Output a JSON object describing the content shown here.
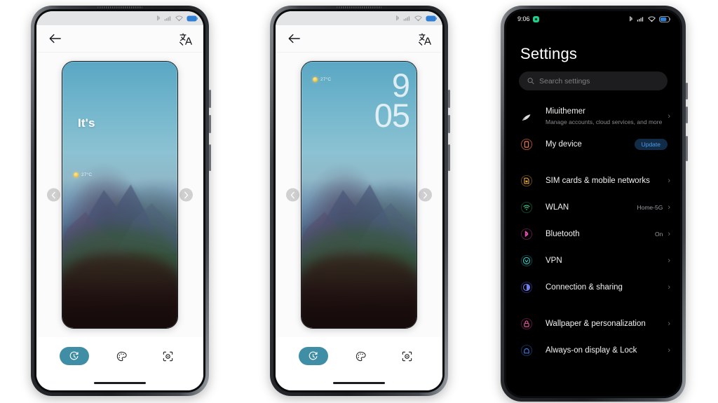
{
  "phones": {
    "wallpaper_clock": {
      "name": "Wallpaper preview - It's",
      "statusbar": {
        "icons": [
          "bluetooth-icon",
          "signal-icon",
          "wifi-icon",
          "battery-icon"
        ]
      },
      "appbar": {
        "back_icon": "back-arrow-icon",
        "translate_icon": "translate-icon"
      },
      "wallpaper": {
        "overlay_text": "It's",
        "weather_temp": "27°C",
        "weather_icon": "sun-icon"
      },
      "carousel": {
        "prev_icon": "chevron-left-icon",
        "next_icon": "chevron-right-icon"
      },
      "toolbar": {
        "items": [
          {
            "icon": "clock-timer-icon",
            "active": true
          },
          {
            "icon": "palette-icon",
            "active": false
          },
          {
            "icon": "focus-frame-icon",
            "active": false
          }
        ]
      }
    },
    "wallpaper_time": {
      "name": "Wallpaper preview - clock",
      "statusbar": {
        "icons": [
          "bluetooth-icon",
          "signal-icon",
          "wifi-icon",
          "battery-icon"
        ]
      },
      "appbar": {
        "back_icon": "back-arrow-icon",
        "translate_icon": "translate-icon"
      },
      "wallpaper": {
        "clock_hour": "9",
        "clock_minute": "05",
        "weather_temp": "27°C",
        "weather_icon": "sun-icon"
      },
      "carousel": {
        "prev_icon": "chevron-left-icon",
        "next_icon": "chevron-right-icon"
      },
      "toolbar": {
        "items": [
          {
            "icon": "clock-timer-icon",
            "active": true
          },
          {
            "icon": "palette-icon",
            "active": false
          },
          {
            "icon": "focus-frame-icon",
            "active": false
          }
        ]
      }
    },
    "settings": {
      "name": "Settings app",
      "statusbar": {
        "time": "9:06",
        "indicator_icon": "green-record-icon",
        "icons": [
          "bluetooth-icon",
          "signal-icon",
          "wifi-icon",
          "battery-icon"
        ]
      },
      "title": "Settings",
      "search": {
        "placeholder": "Search settings",
        "value": "",
        "icon": "search-icon"
      },
      "groups": [
        {
          "rows": [
            {
              "icon": "account-feather-icon",
              "icon_color": "#d9d9d9",
              "title": "Miuithemer",
              "subtitle": "Manage accounts, cloud services, and more",
              "value": "",
              "badge": "",
              "chevron": "›"
            },
            {
              "icon": "device-phone-icon",
              "icon_color": "#e0643c",
              "title": "My device",
              "subtitle": "",
              "value": "",
              "badge": "Update",
              "chevron": ""
            }
          ]
        },
        {
          "rows": [
            {
              "icon": "sim-card-icon",
              "icon_color": "#e0a32e",
              "title": "SIM cards & mobile networks",
              "subtitle": "",
              "value": "",
              "badge": "",
              "chevron": "›"
            },
            {
              "icon": "wifi-icon",
              "icon_color": "#2fbf7e",
              "title": "WLAN",
              "subtitle": "",
              "value": "Home-5G",
              "badge": "",
              "chevron": "›"
            },
            {
              "icon": "bluetooth-icon",
              "icon_color": "#e84bb0",
              "title": "Bluetooth",
              "subtitle": "",
              "value": "On",
              "badge": "",
              "chevron": "›"
            },
            {
              "icon": "vpn-shield-icon",
              "icon_color": "#2fc8c0",
              "title": "VPN",
              "subtitle": "",
              "value": "",
              "badge": "",
              "chevron": "›"
            },
            {
              "icon": "connection-sharing-icon",
              "icon_color": "#6e7ef0",
              "title": "Connection & sharing",
              "subtitle": "",
              "value": "",
              "badge": "",
              "chevron": "›"
            }
          ]
        },
        {
          "rows": [
            {
              "icon": "wallpaper-lock-icon",
              "icon_color": "#e8559f",
              "title": "Wallpaper & personalization",
              "subtitle": "",
              "value": "",
              "badge": "",
              "chevron": "›"
            },
            {
              "icon": "always-on-display-icon",
              "icon_color": "#3b7ae4",
              "title": "Always-on display & Lock",
              "subtitle": "",
              "value": "",
              "badge": "",
              "chevron": "›"
            }
          ]
        }
      ]
    }
  },
  "theme": {
    "accent_teal": "#3f8ea6",
    "badge_blue": "#4d9be8",
    "dark_bg": "#000000",
    "light_bg": "#fbfbfc"
  }
}
